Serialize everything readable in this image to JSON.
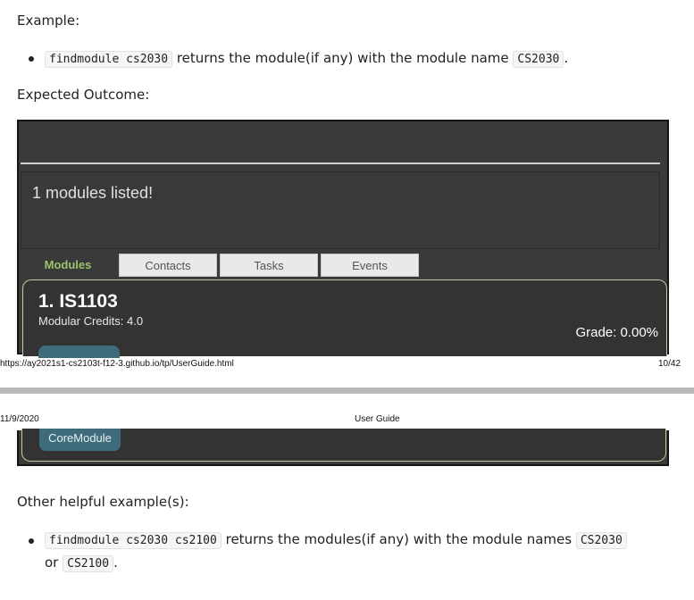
{
  "example_heading": "Example:",
  "example_bullet": {
    "cmd": "findmodule cs2030",
    "mid": " returns the module(if any) with the module name ",
    "code": "CS2030",
    "end": "."
  },
  "expected_heading": "Expected Outcome:",
  "app": {
    "result_text": "1 modules listed!",
    "tabs": [
      "Modules",
      "Contacts",
      "Tasks",
      "Events"
    ],
    "card": {
      "title": "1.  IS1103",
      "credits": "Modular Credits: 4.0",
      "grade": "Grade: 0.00%",
      "tag": "CoreModule"
    }
  },
  "pdf_footer": {
    "url": "https://ay2021s1-cs2103t-f12-3.github.io/tp/UserGuide.html",
    "page": "10/42"
  },
  "pdf_header": {
    "date": "11/9/2020",
    "title": "User Guide"
  },
  "other_heading": "Other helpful example(s):",
  "other_bullet": {
    "cmd": "findmodule cs2030 cs2100",
    "mid": " returns the modules(if any) with the module names ",
    "code1": "CS2030",
    "or": "or ",
    "code2": "CS2100",
    "end": "."
  }
}
